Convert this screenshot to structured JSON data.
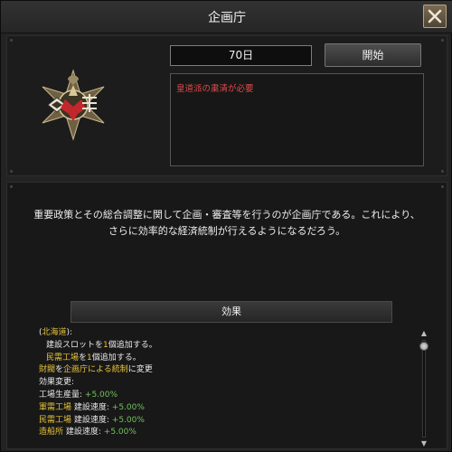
{
  "window": {
    "title": "企画庁",
    "close_icon": "close-icon"
  },
  "focus": {
    "days": "70日",
    "start_label": "開始",
    "requirement": "皇道派の粛清が必要",
    "emblem_icon": "focus-emblem-icon"
  },
  "description": {
    "line1": "重要政策とその総合調整に関して企画・審査等を行うのが企画庁である。これにより、",
    "line2": "さらに効率的な経済統制が行えるようになるだろう。"
  },
  "effects": {
    "header": "効果",
    "lines": [
      {
        "segments": [
          {
            "text": "(",
            "color": "plain"
          },
          {
            "text": "北海道",
            "color": "yellow"
          },
          {
            "text": "):",
            "color": "plain"
          }
        ],
        "indent": 0
      },
      {
        "segments": [
          {
            "text": "建設スロットを",
            "color": "plain"
          },
          {
            "text": "1",
            "color": "yellow"
          },
          {
            "text": "個追加する。",
            "color": "plain"
          }
        ],
        "indent": 1
      },
      {
        "segments": [
          {
            "text": "民需工場",
            "color": "yellow"
          },
          {
            "text": "を",
            "color": "plain"
          },
          {
            "text": "1",
            "color": "yellow"
          },
          {
            "text": "個追加する。",
            "color": "plain"
          }
        ],
        "indent": 1
      },
      {
        "segments": [
          {
            "text": "財閥",
            "color": "yellow"
          },
          {
            "text": "を",
            "color": "plain"
          },
          {
            "text": "企画庁による統制",
            "color": "yellow"
          },
          {
            "text": "に変更",
            "color": "plain"
          }
        ],
        "indent": 0
      },
      {
        "segments": [
          {
            "text": "効果変更:",
            "color": "plain"
          }
        ],
        "indent": 0
      },
      {
        "segments": [
          {
            "text": "工場生産量: ",
            "color": "plain"
          },
          {
            "text": "+5.00%",
            "color": "green"
          }
        ],
        "indent": 0
      },
      {
        "segments": [
          {
            "text": "軍需工場",
            "color": "yellow"
          },
          {
            "text": " 建設速度: ",
            "color": "plain"
          },
          {
            "text": "+5.00%",
            "color": "green"
          }
        ],
        "indent": 0
      },
      {
        "segments": [
          {
            "text": "民需工場",
            "color": "yellow"
          },
          {
            "text": " 建設速度: ",
            "color": "plain"
          },
          {
            "text": "+5.00%",
            "color": "green"
          }
        ],
        "indent": 0
      },
      {
        "segments": [
          {
            "text": "造船所",
            "color": "yellow"
          },
          {
            "text": " 建設速度: ",
            "color": "plain"
          },
          {
            "text": "+5.00%",
            "color": "green"
          }
        ],
        "indent": 0
      }
    ]
  },
  "scrollbar": {
    "up_icon": "scroll-up-arrow-icon",
    "down_icon": "scroll-down-arrow-icon",
    "up_glyph": "▲",
    "down_glyph": "▼"
  },
  "colors": {
    "requirement": "#e0494a",
    "highlight": "#e7c33a",
    "positive": "#72c25e",
    "accent_gold": "#b6a682"
  }
}
